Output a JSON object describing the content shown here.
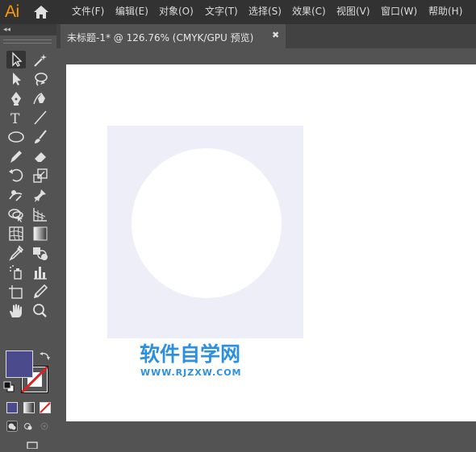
{
  "app": {
    "logo": "Ai",
    "menus": [
      "文件(F)",
      "编辑(E)",
      "对象(O)",
      "文字(T)",
      "选择(S)",
      "效果(C)",
      "视图(V)",
      "窗口(W)",
      "帮助(H)"
    ]
  },
  "toolbox": {
    "collapse": "◂◂",
    "tools": [
      {
        "name": "selection-tool-icon"
      },
      {
        "name": "magic-wand-tool-icon"
      },
      {
        "name": "direct-selection-tool-icon"
      },
      {
        "name": "lasso-tool-icon"
      },
      {
        "name": "pen-tool-icon"
      },
      {
        "name": "curvature-tool-icon"
      },
      {
        "name": "type-tool-icon",
        "glyph": "T"
      },
      {
        "name": "line-segment-tool-icon"
      },
      {
        "name": "ellipse-tool-icon"
      },
      {
        "name": "paintbrush-tool-icon"
      },
      {
        "name": "pencil-tool-icon"
      },
      {
        "name": "eraser-tool-icon"
      },
      {
        "name": "rotate-tool-icon"
      },
      {
        "name": "scale-tool-icon"
      },
      {
        "name": "puppet-warp-tool-icon"
      },
      {
        "name": "pin-tool-icon"
      },
      {
        "name": "shape-builder-tool-icon"
      },
      {
        "name": "perspective-grid-tool-icon"
      },
      {
        "name": "mesh-tool-icon"
      },
      {
        "name": "gradient-tool-icon"
      },
      {
        "name": "eyedropper-tool-icon"
      },
      {
        "name": "blend-tool-icon"
      },
      {
        "name": "symbol-sprayer-tool-icon"
      },
      {
        "name": "column-graph-tool-icon"
      },
      {
        "name": "artboard-tool-icon"
      },
      {
        "name": "slice-tool-icon"
      },
      {
        "name": "hand-tool-icon"
      },
      {
        "name": "zoom-tool-icon"
      }
    ],
    "fill_color": "#4a4a8c",
    "stroke_color": "none"
  },
  "document": {
    "tab_title": "未标题-1* @ 126.76% (CMYK/GPU 预览)",
    "close": "✖"
  },
  "artwork": {
    "square_color": "#eeeef8",
    "circle_color": "#ffffff"
  },
  "watermark": {
    "title": "软件自学网",
    "url": "WWW.RJZXW.COM",
    "color": "#2d8fe0"
  }
}
